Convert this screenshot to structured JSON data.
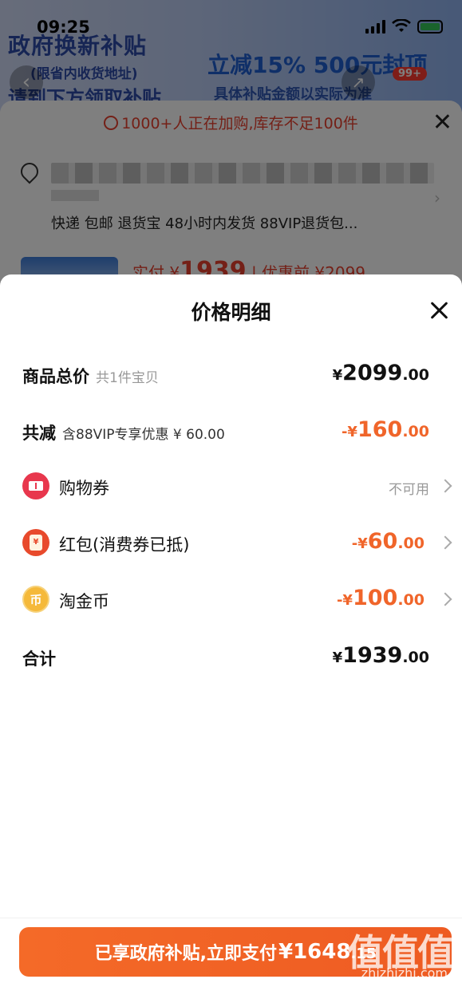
{
  "status_bar": {
    "time": "09:25"
  },
  "background": {
    "banner": {
      "left_line1": "政府换新补贴",
      "left_line2": "(限省内收货地址)",
      "left_line3": "请到下方领取补贴",
      "right_line1": "立减15% 500元封顶",
      "right_line2": "具体补贴金额以实际为准"
    },
    "cart_badge": "99+",
    "stock_notice": "1000+人正在加购,库存不足100件",
    "services": "快递 包邮 退货宝 48小时内发货 88VIP退货包...",
    "paid_label": "实付 ¥",
    "paid_value": "1939",
    "before_discount": "| 优惠前 ¥2099"
  },
  "sheet": {
    "title": "价格明细",
    "rows": {
      "total": {
        "label": "商品总价",
        "sub": "共1件宝贝",
        "yen": "¥",
        "int": "2099",
        "dec": ".00"
      },
      "discount": {
        "label": "共减",
        "sub": "含88VIP专享优惠 ¥ 60.00",
        "yen": "-¥",
        "int": "160",
        "dec": ".00"
      },
      "coupon": {
        "icon": "ticket-icon",
        "label": "购物券",
        "status": "不可用"
      },
      "redpacket": {
        "icon": "red-packet-icon",
        "label": "红包(消费券已抵)",
        "yen": "-¥",
        "int": "60",
        "dec": ".00"
      },
      "coins": {
        "icon": "coin-icon",
        "icon_glyph": "币",
        "label": "淘金币",
        "yen": "-¥",
        "int": "100",
        "dec": ".00"
      },
      "sum": {
        "label": "合计",
        "yen": "¥",
        "int": "1939",
        "dec": ".00"
      }
    }
  },
  "pay_button": {
    "prefix": "已享政府补贴,立即支付",
    "yen": "¥",
    "int": "1648",
    "dec": ".15"
  },
  "watermark": {
    "logo": "值值值",
    "site": "zhizhizhi.com"
  },
  "colors": {
    "accent_orange": "#f0652a",
    "pay_button": "#f46a28",
    "stock_red": "#e8402e"
  }
}
